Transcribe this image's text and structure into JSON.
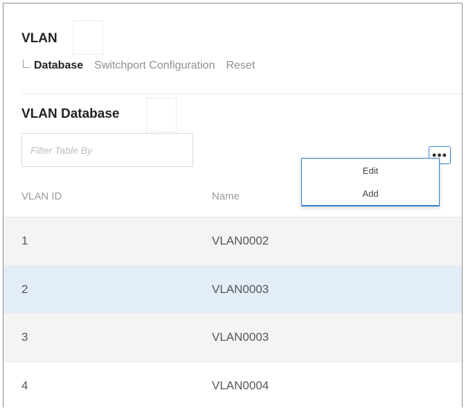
{
  "header": {
    "title": "VLAN",
    "breadcrumb": [
      {
        "label": "Database",
        "active": true
      },
      {
        "label": "Switchport Configuration",
        "active": false
      },
      {
        "label": "Reset",
        "active": false
      }
    ]
  },
  "section": {
    "title": "VLAN Database"
  },
  "filter": {
    "placeholder": "Filter Table By",
    "value": ""
  },
  "more_button": {
    "icon": "more-horizontal-icon",
    "glyph": "•••"
  },
  "context_menu": {
    "items": [
      {
        "label": "Edit"
      },
      {
        "label": "Add"
      }
    ]
  },
  "table": {
    "columns": [
      "VLAN ID",
      "Name"
    ],
    "rows": [
      {
        "id": "1",
        "name": "VLAN0002"
      },
      {
        "id": "2",
        "name": "VLAN0003",
        "selected": true
      },
      {
        "id": "3",
        "name": "VLAN0003"
      },
      {
        "id": "4",
        "name": "VLAN0004"
      }
    ]
  },
  "colors": {
    "accent": "#2f7fcf",
    "selected_row": "#e2edf8",
    "alt_row": "#f4f4f4"
  }
}
